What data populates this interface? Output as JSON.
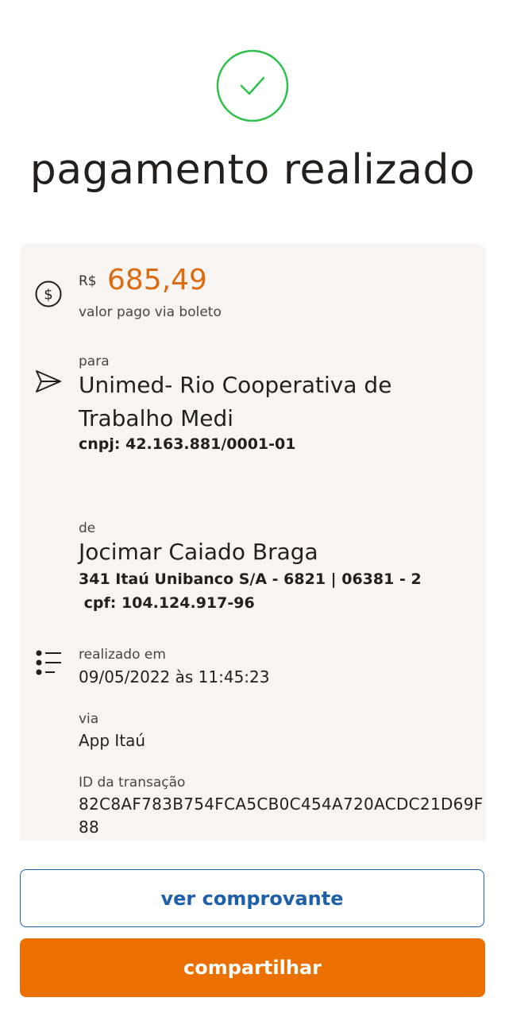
{
  "header": {
    "title": "pagamento realizado",
    "success_icon": "check-circle-icon"
  },
  "payment": {
    "currency": "R$",
    "amount": "685,49",
    "amount_label": "valor pago via boleto",
    "amount_icon": "dollar-circle-icon"
  },
  "recipient": {
    "label": "para",
    "name": "Unimed- Rio Cooperativa de Trabalho Medi",
    "document": "cnpj: 42.163.881/0001-01",
    "icon": "send-arrow-icon"
  },
  "payer": {
    "label": "de",
    "name": "Jocimar Caiado Braga",
    "bank_account": "341 Itaú Unibanco S/A - 6821 | 06381 - 2",
    "document": " cpf: 104.124.917-96"
  },
  "details": {
    "icon": "list-icon",
    "date_label": "realizado em",
    "date_value": "09/05/2022 às 11:45:23",
    "channel_label": "via",
    "channel_value": "App Itaú",
    "transaction_label": "ID da transação",
    "transaction_id": "82C8AF783B754FCA5CB0C454A720ACDC21D69F88"
  },
  "actions": {
    "view_receipt": "ver comprovante",
    "share": "compartilhar"
  },
  "colors": {
    "success": "#2fbf4a",
    "amount": "#d96c10",
    "primary": "#ec7000",
    "link": "#1d5fa8",
    "card_bg": "#f7f4f2"
  }
}
